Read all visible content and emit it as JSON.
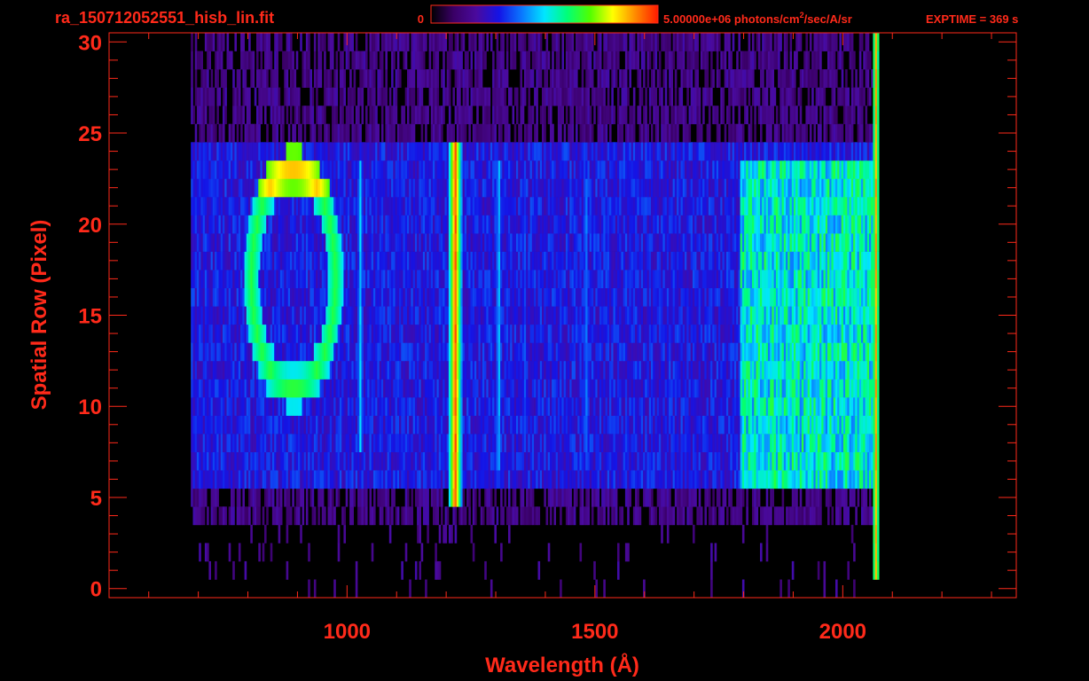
{
  "chart_data": {
    "type": "heatmap",
    "title": "ra_150712052551_hisb_lin.fit",
    "colorbar": {
      "min_label": "0",
      "max_label_prefix": "5.00000e+06 photons/cm",
      "max_label_sup": "2",
      "max_label_suffix": "/sec/A/sr",
      "min": 0,
      "max": 5000000,
      "colormap": "rainbow",
      "stops": [
        "#000000",
        "#3a0066",
        "#4a0a9e",
        "#1414e6",
        "#0a78ff",
        "#00e6ff",
        "#00ff78",
        "#50ff00",
        "#ffff00",
        "#ff8a00",
        "#ff1a00"
      ]
    },
    "exptime_label": "EXPTIME = 369 s",
    "xlabel": "Wavelength (Å)",
    "ylabel": "Spatial Row (Pixel)",
    "xlim": [
      520,
      2350
    ],
    "ylim": [
      -0.5,
      30.5
    ],
    "x_ticks": [
      1000,
      1500,
      2000
    ],
    "y_ticks": [
      0,
      5,
      10,
      15,
      20,
      25,
      30
    ],
    "x_minor_step": 100,
    "y_minor_step": 1,
    "data_extent": {
      "x_min": 685,
      "x_max": 2070,
      "rows_signal": [
        6,
        24
      ],
      "rows_noise": [
        4,
        30
      ]
    },
    "features": [
      {
        "name": "ring",
        "type": "ellipse",
        "x_center": 890,
        "y_center": 17,
        "x_radius": 85,
        "y_radius": 6
      },
      {
        "name": "line-1025",
        "type": "line",
        "x": 1025,
        "rows": [
          8,
          23
        ],
        "level": 0.45
      },
      {
        "name": "line-1216",
        "type": "line",
        "x": 1216,
        "rows": [
          5,
          24
        ],
        "level": 0.95
      },
      {
        "name": "line-1304",
        "type": "line",
        "x": 1304,
        "rows": [
          7,
          23
        ],
        "level": 0.45
      },
      {
        "name": "line-1356",
        "type": "line",
        "x": 1356,
        "rows": [
          8,
          22
        ],
        "level": 0.35
      },
      {
        "name": "line-1480",
        "type": "line",
        "x": 1480,
        "rows": [
          8,
          22
        ],
        "level": 0.4
      },
      {
        "name": "band-1800-2070",
        "type": "band",
        "x": [
          1790,
          2070
        ],
        "rows": [
          6,
          23
        ],
        "level": 0.55
      },
      {
        "name": "edge-2065",
        "type": "line",
        "x": 2065,
        "rows": [
          1,
          30
        ],
        "level": 0.85
      }
    ]
  },
  "colors": {
    "text": "#ff2a1a",
    "axes": "#ff2a1a",
    "background": "#000000"
  }
}
